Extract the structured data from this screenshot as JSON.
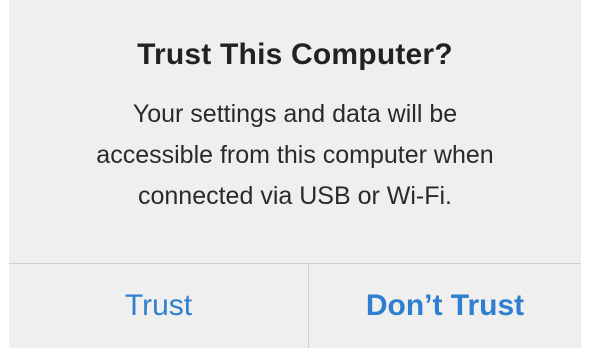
{
  "alert": {
    "title": "Trust This Computer?",
    "message_lines": [
      "Your settings and data will be",
      "accessible from this computer when",
      "connected via USB or Wi-Fi."
    ],
    "buttons": {
      "trust_label": "Trust",
      "dont_trust_label": "Don’t Trust"
    }
  },
  "colors": {
    "background": "#efefef",
    "button_text": "#2f7fd0",
    "divider": "#cfcfcf",
    "title_text": "#222222"
  }
}
